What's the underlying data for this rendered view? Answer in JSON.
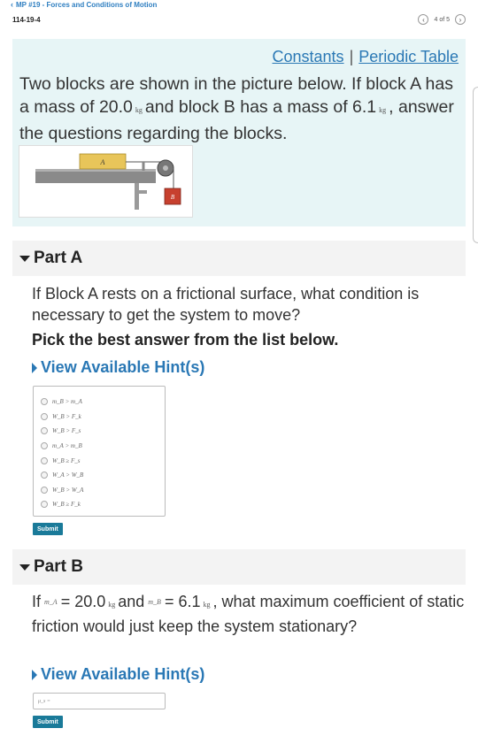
{
  "topbar": {
    "back_label": "MP #19 - Forces and Conditions of Motion"
  },
  "course": {
    "code": "114-19-4"
  },
  "pager": {
    "text": "4 of 5"
  },
  "intro": {
    "link_constants": "Constants",
    "separator": "|",
    "link_periodic": "Periodic Table",
    "text_1": "Two blocks are shown in the picture below. If block A has a mass of 20.0",
    "unit_1": "kg",
    "text_2": "and block B has a mass of 6.1",
    "unit_2": "kg",
    "text_3": ", answer the questions regarding the blocks.",
    "figure": {
      "label_a": "A",
      "label_b": "B"
    }
  },
  "partA": {
    "title": "Part A",
    "question": "If Block A rests on a frictional surface, what condition is necessary to get the system to move?",
    "pick": "Pick the best answer from the list below.",
    "hint": "View Available Hint(s)",
    "choices": [
      "m_B > m_A",
      "W_B > F_k",
      "W_B > F_s",
      "m_A > m_B",
      "W_B ≥ F_s",
      "W_A > W_B",
      "W_B > W_A",
      "W_B ≥ F_k"
    ],
    "submit": "Submit"
  },
  "partB": {
    "title": "Part B",
    "q_if": "If",
    "sym_ma": "m_A",
    "q_eq1": "= 20.0",
    "unit1": "kg",
    "q_and": "and",
    "sym_mb": "m_B",
    "q_eq2": "= 6.1",
    "unit2": "kg",
    "q_rest": ", what maximum coefficient of static friction would just keep the system stationary?",
    "hint": "View Available Hint(s)",
    "answer_label": "μ_s =",
    "submit": "Submit"
  },
  "colors": {
    "accent": "#2a78b5",
    "intro_bg": "#e7f5f6",
    "button": "#1a7a99"
  }
}
